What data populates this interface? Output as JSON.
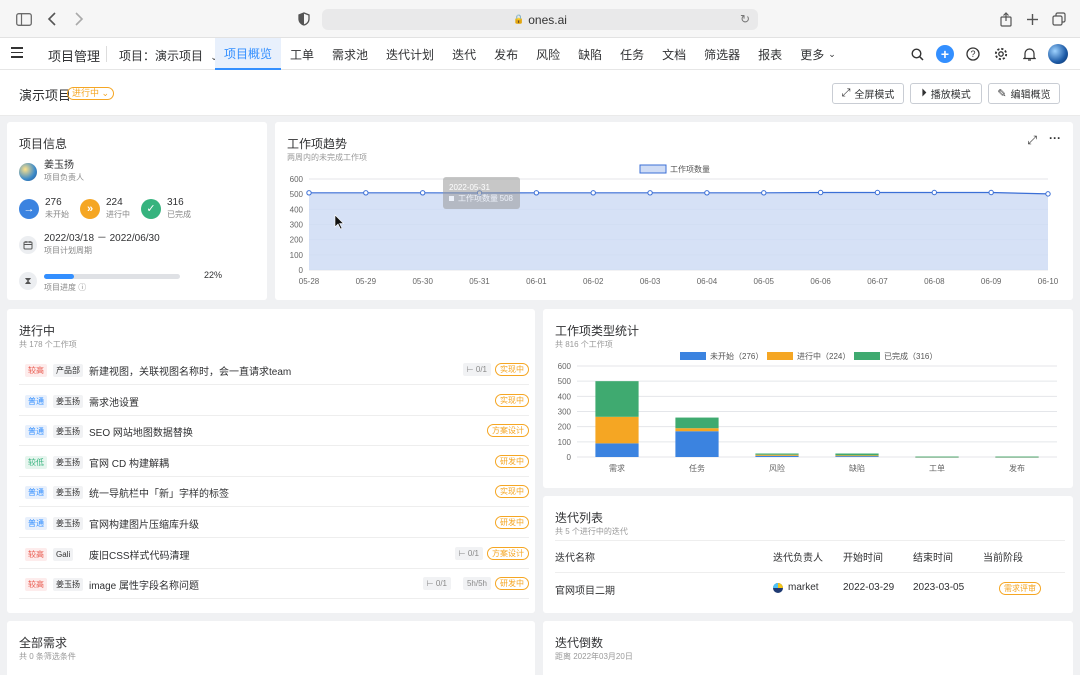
{
  "browser": {
    "url": "ones.ai"
  },
  "nav": {
    "title": "项目管理",
    "project": "项目：演示项目",
    "tabs": [
      {
        "label": "项目概览",
        "active": true
      },
      {
        "label": "工单"
      },
      {
        "label": "需求池"
      },
      {
        "label": "迭代计划"
      },
      {
        "label": "迭代"
      },
      {
        "label": "发布"
      },
      {
        "label": "风险"
      },
      {
        "label": "缺陷"
      },
      {
        "label": "任务"
      },
      {
        "label": "文档"
      },
      {
        "label": "筛选器"
      },
      {
        "label": "报表"
      },
      {
        "label": "更多"
      }
    ]
  },
  "header": {
    "title": "演示项目",
    "status": "进行中",
    "buttons": {
      "fullscreen": "全屏模式",
      "play": "播放模式",
      "edit": "编辑概览"
    }
  },
  "project_info": {
    "title": "项目信息",
    "owner_name": "姜玉扬",
    "owner_role": "项目负责人",
    "stats": [
      {
        "value": "276",
        "label": "未开始",
        "color": "#3b83e0"
      },
      {
        "value": "224",
        "label": "进行中",
        "color": "#f5a623"
      },
      {
        "value": "316",
        "label": "已完成",
        "color": "#36b37e"
      }
    ],
    "period": "2022/03/18 － 2022/06/30",
    "period_label": "项目计划周期",
    "progress_label": "项目进度",
    "progress_value": 22,
    "progress_text": "22%"
  },
  "trend": {
    "title": "工作项趋势",
    "subtitle": "两周内的未完成工作项",
    "tooltip_date": "2022-05-31",
    "tooltip_label": "工作项数量",
    "tooltip_value": "508"
  },
  "in_progress": {
    "title": "进行中",
    "subtitle": "共 178 个工作项",
    "items": [
      {
        "priority": "较高",
        "pri_class": "pri-high",
        "user": "产品部",
        "name": "新建视图，关联视图名称时，会一直请求team",
        "sub": "0/1",
        "status": "实现中"
      },
      {
        "priority": "普通",
        "pri_class": "pri-normal",
        "user": "姜玉扬",
        "name": "需求池设置",
        "status": "实现中"
      },
      {
        "priority": "普通",
        "pri_class": "pri-normal",
        "user": "姜玉扬",
        "name": "SEO 网站地图数据替换",
        "status": "方案设计"
      },
      {
        "priority": "较低",
        "pri_class": "pri-low",
        "user": "姜玉扬",
        "name": "官网 CD 构建解耦",
        "status": "研发中"
      },
      {
        "priority": "普通",
        "pri_class": "pri-normal",
        "user": "姜玉扬",
        "name": "统一导航栏中「新」字样的标签",
        "status": "实现中"
      },
      {
        "priority": "普通",
        "pri_class": "pri-normal",
        "user": "姜玉扬",
        "name": "官网构建图片压缩库升级",
        "status": "研发中"
      },
      {
        "priority": "较高",
        "pri_class": "pri-high",
        "user": "Gali",
        "name": "废旧CSS样式代码清理",
        "sub": "0/1",
        "status": "方案设计"
      },
      {
        "priority": "较高",
        "pri_class": "pri-high",
        "user": "姜玉扬",
        "name": "image 属性字段名称问题",
        "sub": "0/1",
        "time": "5h/5h",
        "status": "研发中"
      }
    ]
  },
  "type_stats": {
    "title": "工作项类型统计",
    "subtitle": "共 816 个工作项"
  },
  "iterations": {
    "title": "迭代列表",
    "subtitle": "共 5 个进行中的迭代",
    "headers": [
      "迭代名称",
      "迭代负责人",
      "开始时间",
      "结束时间",
      "当前阶段"
    ],
    "rows": [
      {
        "name": "官网项目二期",
        "owner": "market",
        "start": "2022-03-29",
        "end": "2023-03-05",
        "stage": "需求评审"
      }
    ]
  },
  "all_requirements": {
    "title": "全部需求",
    "subtitle": "共 0 条筛选条件"
  },
  "countdown": {
    "title": "迭代倒数",
    "subtitle": "距离 2022年03月20日"
  },
  "chart_data": [
    {
      "type": "area",
      "title": "工作项趋势",
      "series": [
        {
          "name": "工作项数量",
          "values": [
            509,
            509,
            509,
            508,
            509,
            509,
            509,
            509,
            509,
            511,
            511,
            511,
            511,
            502
          ],
          "color": "#3b6fd6"
        }
      ],
      "categories": [
        "05-28",
        "05-29",
        "05-30",
        "05-31",
        "06-01",
        "06-02",
        "06-03",
        "06-04",
        "06-05",
        "06-06",
        "06-07",
        "06-08",
        "06-09",
        "06-10"
      ],
      "yticks": [
        0,
        100,
        200,
        300,
        400,
        500,
        600
      ],
      "ylim": [
        0,
        600
      ],
      "grid": true,
      "legend": "top-center"
    },
    {
      "type": "bar",
      "stacked": true,
      "title": "工作项类型统计",
      "categories": [
        "需求",
        "任务",
        "风险",
        "缺陷",
        "工单",
        "发布"
      ],
      "series": [
        {
          "name": "未开始（276）",
          "values": [
            90,
            170,
            8,
            6,
            1,
            1
          ],
          "color": "#3b83e0"
        },
        {
          "name": "进行中（224）",
          "values": [
            175,
            20,
            7,
            5,
            1,
            1
          ],
          "color": "#f5a623"
        },
        {
          "name": "已完成（316）",
          "values": [
            235,
            70,
            8,
            12,
            1,
            1
          ],
          "color": "#3faa70"
        }
      ],
      "yticks": [
        0,
        100,
        200,
        300,
        400,
        500,
        600
      ],
      "ylim": [
        0,
        600
      ],
      "grid": true,
      "legend": "top-center"
    }
  ]
}
